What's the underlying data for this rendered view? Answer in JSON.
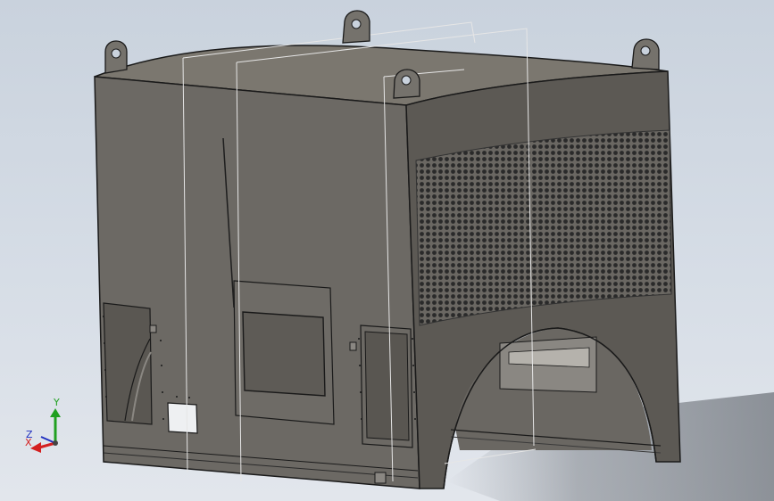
{
  "viewport": {
    "background_top": "#c9d2dd",
    "background_bottom": "#e2e6ec"
  },
  "model": {
    "body_color": "#6e6b66",
    "side_color": "#5d5a55",
    "top_color": "#7a766f",
    "edge_color": "#1e1e1e",
    "sketch_line_color": "#e8e8e8",
    "perforation_color": "#2b2b2b"
  },
  "triad": {
    "x_label": "X",
    "y_label": "Y",
    "z_label": "Z",
    "x_color": "#d42020",
    "y_color": "#20a020",
    "z_color": "#2030c0"
  }
}
